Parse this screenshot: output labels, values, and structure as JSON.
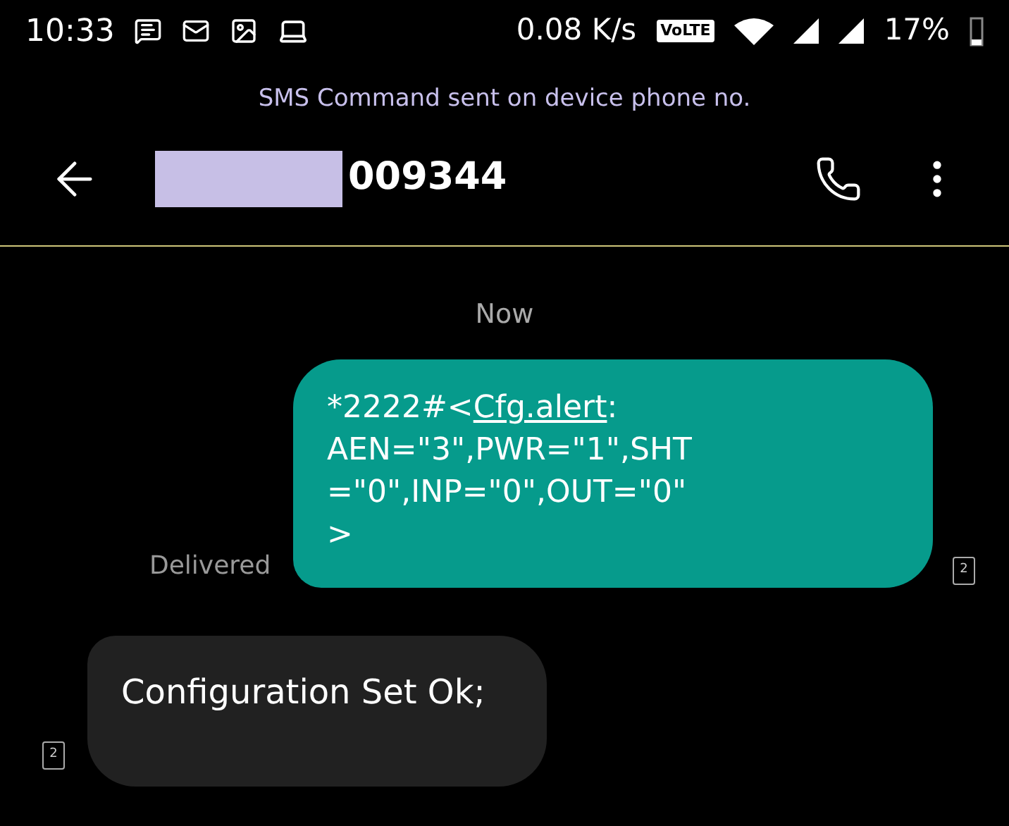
{
  "status_bar": {
    "time": "10:33",
    "speed": "0.08 K/s",
    "volte": "VoLTE",
    "battery": "17%"
  },
  "banner": "SMS Command sent on device phone no.",
  "header": {
    "contact": "009344"
  },
  "timestamp": "Now",
  "messages": [
    {
      "kind": "sent",
      "lines": [
        {
          "before": "*2222#<",
          "link": "Cfg.alert",
          "after": ":"
        },
        {
          "before": "AEN=\"3\",PWR=\"1\",SHT"
        },
        {
          "before": "=\"0\",INP=\"0\",OUT=\"0\""
        },
        {
          "before": ">"
        }
      ],
      "status": "Delivered",
      "sim": "2"
    },
    {
      "kind": "received",
      "lines": [
        {
          "before": "Configuration Set Ok;"
        }
      ],
      "sim": "2"
    }
  ]
}
